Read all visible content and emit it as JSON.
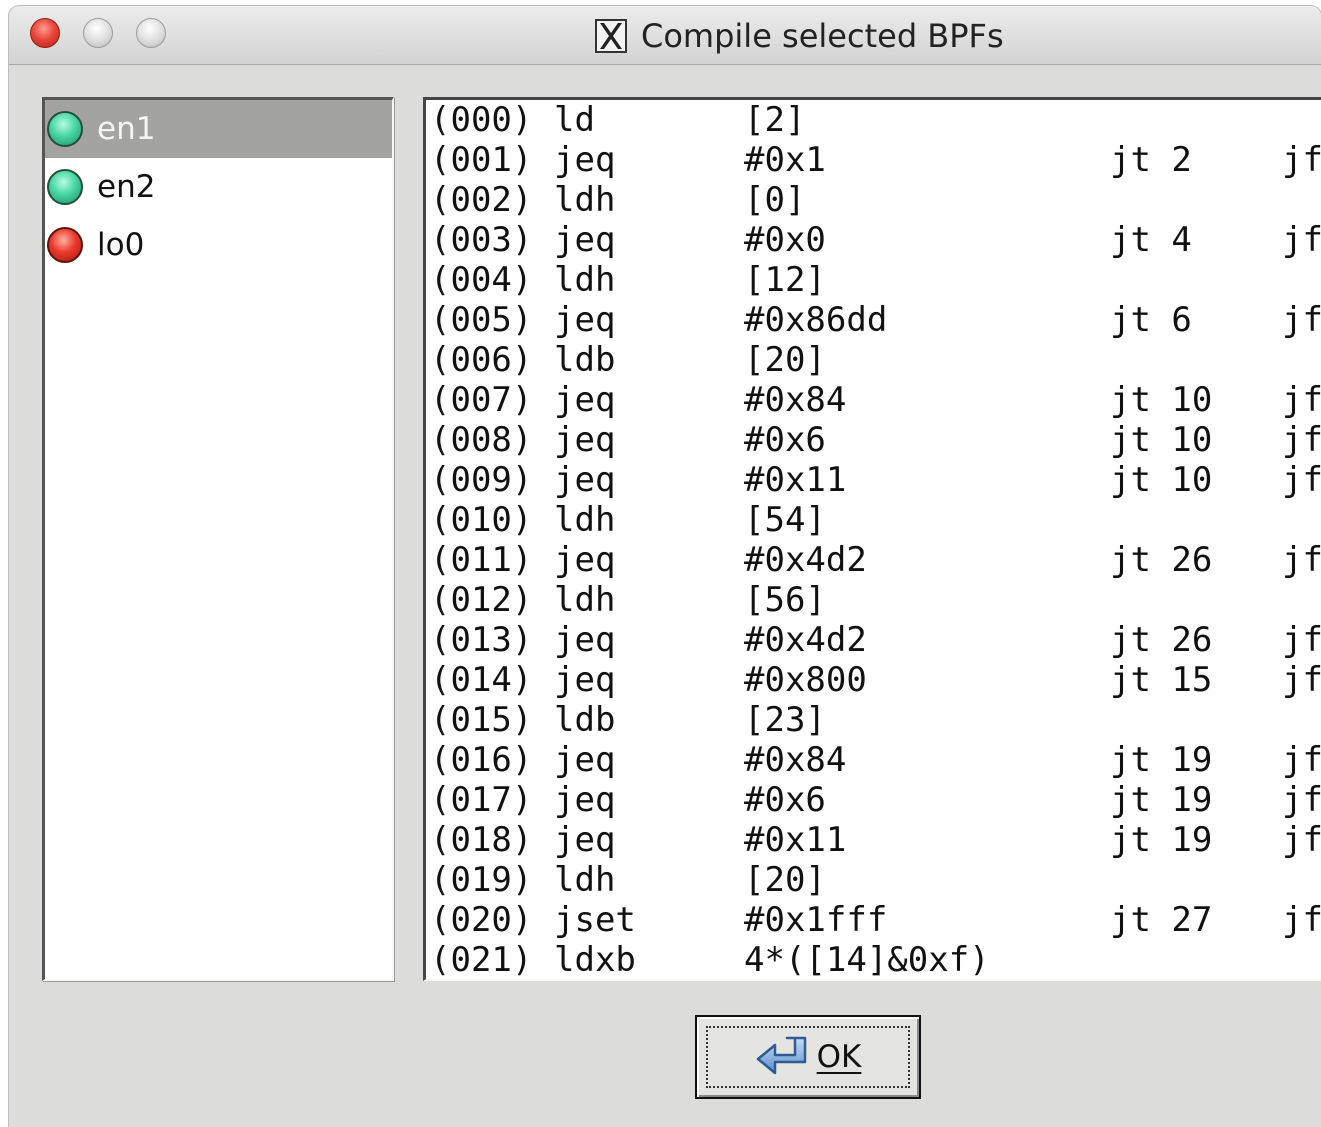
{
  "window": {
    "title": "Compile selected BPFs",
    "title_icon": "x11-icon"
  },
  "interfaces": [
    {
      "name": "en1",
      "status": "up",
      "color": "#3fd39c",
      "selected": true
    },
    {
      "name": "en2",
      "status": "up",
      "color": "#3fd39c",
      "selected": false
    },
    {
      "name": "lo0",
      "status": "down",
      "color": "#e5352a",
      "selected": false
    }
  ],
  "bpf": {
    "rows": [
      {
        "idx": "(000)",
        "op": "ld",
        "arg": "[2]",
        "jt": "",
        "jf": ""
      },
      {
        "idx": "(001)",
        "op": "jeq",
        "arg": "#0x1",
        "jt": "jt 2",
        "jf": "jf"
      },
      {
        "idx": "(002)",
        "op": "ldh",
        "arg": "[0]",
        "jt": "",
        "jf": ""
      },
      {
        "idx": "(003)",
        "op": "jeq",
        "arg": "#0x0",
        "jt": "jt 4",
        "jf": "jf"
      },
      {
        "idx": "(004)",
        "op": "ldh",
        "arg": "[12]",
        "jt": "",
        "jf": ""
      },
      {
        "idx": "(005)",
        "op": "jeq",
        "arg": "#0x86dd",
        "jt": "jt 6",
        "jf": "jf"
      },
      {
        "idx": "(006)",
        "op": "ldb",
        "arg": "[20]",
        "jt": "",
        "jf": ""
      },
      {
        "idx": "(007)",
        "op": "jeq",
        "arg": "#0x84",
        "jt": "jt 10",
        "jf": "jf"
      },
      {
        "idx": "(008)",
        "op": "jeq",
        "arg": "#0x6",
        "jt": "jt 10",
        "jf": "jf"
      },
      {
        "idx": "(009)",
        "op": "jeq",
        "arg": "#0x11",
        "jt": "jt 10",
        "jf": "jf"
      },
      {
        "idx": "(010)",
        "op": "ldh",
        "arg": "[54]",
        "jt": "",
        "jf": ""
      },
      {
        "idx": "(011)",
        "op": "jeq",
        "arg": "#0x4d2",
        "jt": "jt 26",
        "jf": "jf"
      },
      {
        "idx": "(012)",
        "op": "ldh",
        "arg": "[56]",
        "jt": "",
        "jf": ""
      },
      {
        "idx": "(013)",
        "op": "jeq",
        "arg": "#0x4d2",
        "jt": "jt 26",
        "jf": "jf"
      },
      {
        "idx": "(014)",
        "op": "jeq",
        "arg": "#0x800",
        "jt": "jt 15",
        "jf": "jf"
      },
      {
        "idx": "(015)",
        "op": "ldb",
        "arg": "[23]",
        "jt": "",
        "jf": ""
      },
      {
        "idx": "(016)",
        "op": "jeq",
        "arg": "#0x84",
        "jt": "jt 19",
        "jf": "jf"
      },
      {
        "idx": "(017)",
        "op": "jeq",
        "arg": "#0x6",
        "jt": "jt 19",
        "jf": "jf"
      },
      {
        "idx": "(018)",
        "op": "jeq",
        "arg": "#0x11",
        "jt": "jt 19",
        "jf": "jf"
      },
      {
        "idx": "(019)",
        "op": "ldh",
        "arg": "[20]",
        "jt": "",
        "jf": ""
      },
      {
        "idx": "(020)",
        "op": "jset",
        "arg": "#0x1fff",
        "jt": "jt 27",
        "jf": "jf"
      },
      {
        "idx": "(021)",
        "op": "ldxb",
        "arg": "4*([14]&0xf)",
        "jt": "",
        "jf": ""
      }
    ]
  },
  "buttons": {
    "ok_label": "OK",
    "ok_icon": "enter-arrow-icon"
  }
}
